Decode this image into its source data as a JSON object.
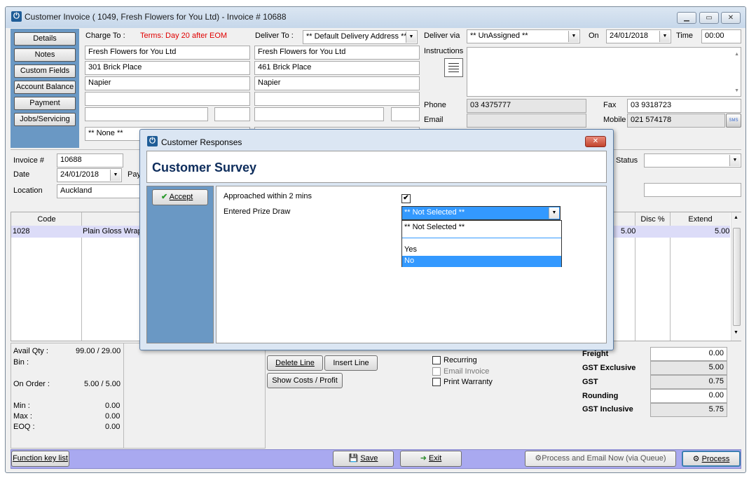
{
  "window": {
    "title": "Customer Invoice ( 1049, Fresh Flowers for You Ltd) - Invoice # 10688",
    "minimize": "▭",
    "maximize": "▭",
    "close": "✕"
  },
  "sidebar": {
    "items": [
      {
        "label": "Details"
      },
      {
        "label": "Notes"
      },
      {
        "label": "Custom Fields"
      },
      {
        "label": "Account Balance"
      },
      {
        "label": "Payment"
      },
      {
        "label": "Jobs/Servicing"
      }
    ]
  },
  "charge_to": {
    "label": "Charge To :",
    "terms": "Terms: Day 20 after EOM",
    "lines": [
      "Fresh Flowers for You Ltd",
      "301 Brick Place",
      "Napier",
      ""
    ],
    "contact": "** None **"
  },
  "deliver_to": {
    "label": "Deliver To :",
    "address_select": "** Default Delivery Address **",
    "lines": [
      "Fresh Flowers for You Ltd",
      "461 Brick Place",
      "Napier",
      ""
    ]
  },
  "delivery": {
    "via_label": "Deliver via",
    "via_value": "** UnAssigned **",
    "on_label": "On",
    "on_value": "24/01/2018",
    "time_label": "Time",
    "time_value": "00:00",
    "instructions_label": "Instructions"
  },
  "contact": {
    "phone_label": "Phone",
    "phone": "03 4375777",
    "fax_label": "Fax",
    "fax": "03 9318723",
    "email_label": "Email",
    "email": "",
    "mobile_label": "Mobile",
    "mobile": "021 574178",
    "sms_label": "SMS"
  },
  "invoice": {
    "invoice_label": "Invoice #",
    "invoice_no": "10688",
    "date_label": "Date",
    "date": "24/01/2018",
    "pay_label": "Pay",
    "location_label": "Location",
    "location": "Auckland",
    "status_label": "Status"
  },
  "grid": {
    "headers": {
      "code": "Code",
      "disc": "Disc %",
      "extend": "Extend"
    },
    "rows": [
      {
        "code": "1028",
        "desc": "Plain Gloss Wrap",
        "price": "5.00",
        "disc": "",
        "extend": "5.00"
      }
    ]
  },
  "stock": {
    "avail_label": "Avail Qty :",
    "avail": "99.00 / 29.00",
    "bin_label": "Bin :",
    "on_order_label": "On Order :",
    "on_order": "5.00 / 5.00",
    "min_label": "Min :",
    "min": "0.00",
    "max_label": "Max :",
    "max": "0.00",
    "eoq_label": "EOQ :",
    "eoq": "0.00"
  },
  "line_actions": {
    "delete": "Delete Line",
    "insert": "Insert Line",
    "costs": "Show Costs / Profit"
  },
  "options": {
    "recurring": "Recurring",
    "email_invoice": "Email Invoice",
    "print_warranty": "Print Warranty"
  },
  "totals": {
    "freight_label": "Freight",
    "freight": "0.00",
    "gst_excl_label": "GST Exclusive",
    "gst_excl": "5.00",
    "gst_label": "GST",
    "gst": "0.75",
    "rounding_label": "Rounding",
    "rounding": "0.00",
    "gst_incl_label": "GST Inclusive",
    "gst_incl": "5.75"
  },
  "footer": {
    "function_keys": "Function key list",
    "save": "Save",
    "exit": "Exit",
    "process_email": "Process and Email Now (via Queue)",
    "process": "Process"
  },
  "dialog": {
    "title": "Customer Responses",
    "heading": "Customer Survey",
    "accept": "Accept",
    "q1": "Approached within 2 mins",
    "q1_checked": "✔",
    "q2": "Entered Prize Draw",
    "q2_value": "** Not Selected **",
    "options": [
      "** Not Selected **",
      "",
      "Yes",
      "No"
    ]
  },
  "colors": {
    "sidebar_blue": "#6a98c4",
    "terms_red": "#e00000",
    "heading_navy": "#0e2d5c",
    "selected_blue": "#3399ff",
    "row_highlight": "#dcdcf8",
    "footer_purple": "#a9a9f0"
  }
}
